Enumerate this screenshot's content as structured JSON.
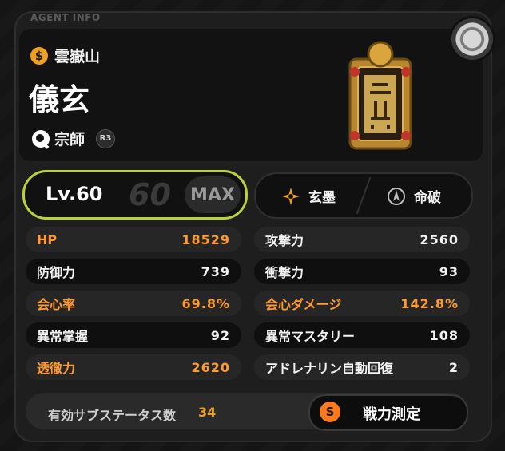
{
  "header": {
    "label": "AGENT INFO"
  },
  "agent": {
    "faction": "雲嶽山",
    "name": "儀玄",
    "rank_name": "宗師",
    "rank_badge": "R3"
  },
  "level": {
    "lv_label": "Lv.60",
    "lv_cap": "60",
    "max_label": "MAX"
  },
  "skills": [
    {
      "name": "玄墨",
      "icon": "shuriken-icon"
    },
    {
      "name": "命破",
      "icon": "spike-emblem-icon"
    }
  ],
  "stats_left": [
    {
      "label": "HP",
      "value": "18529",
      "highlight": true
    },
    {
      "label": "防御力",
      "value": "739",
      "highlight": false
    },
    {
      "label": "会心率",
      "value": "69.8%",
      "highlight": true
    },
    {
      "label": "異常掌握",
      "value": "92",
      "highlight": false
    },
    {
      "label": "透徹力",
      "value": "2620",
      "highlight": true
    }
  ],
  "stats_right": [
    {
      "label": "攻撃力",
      "value": "2560",
      "highlight": false
    },
    {
      "label": "衝撃力",
      "value": "93",
      "highlight": false
    },
    {
      "label": "会心ダメージ",
      "value": "142.8%",
      "highlight": true
    },
    {
      "label": "異常マスタリー",
      "value": "108",
      "highlight": false
    },
    {
      "label": "アドレナリン自動回復",
      "value": "2",
      "highlight": false
    }
  ],
  "footer": {
    "substat_label": "有効サブステータス数",
    "substat_value": "34",
    "power_icon": "S",
    "power_label": "戦力測定"
  },
  "colors": {
    "accent_orange": "#ff9a2e",
    "level_border": "#b6d43a"
  }
}
